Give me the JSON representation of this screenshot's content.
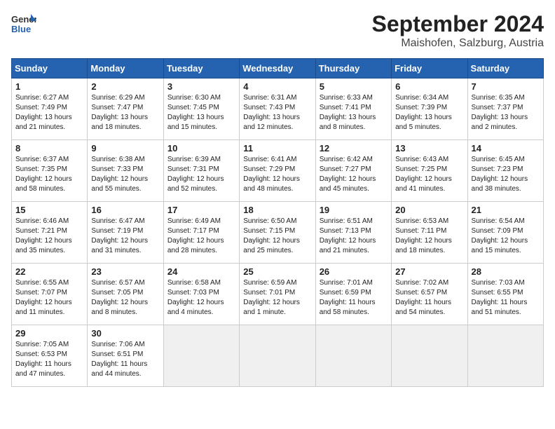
{
  "header": {
    "logo_line1": "General",
    "logo_line2": "Blue",
    "month": "September 2024",
    "location": "Maishofen, Salzburg, Austria"
  },
  "days_of_week": [
    "Sunday",
    "Monday",
    "Tuesday",
    "Wednesday",
    "Thursday",
    "Friday",
    "Saturday"
  ],
  "weeks": [
    [
      {
        "day": "1",
        "content": "Sunrise: 6:27 AM\nSunset: 7:49 PM\nDaylight: 13 hours\nand 21 minutes."
      },
      {
        "day": "2",
        "content": "Sunrise: 6:29 AM\nSunset: 7:47 PM\nDaylight: 13 hours\nand 18 minutes."
      },
      {
        "day": "3",
        "content": "Sunrise: 6:30 AM\nSunset: 7:45 PM\nDaylight: 13 hours\nand 15 minutes."
      },
      {
        "day": "4",
        "content": "Sunrise: 6:31 AM\nSunset: 7:43 PM\nDaylight: 13 hours\nand 12 minutes."
      },
      {
        "day": "5",
        "content": "Sunrise: 6:33 AM\nSunset: 7:41 PM\nDaylight: 13 hours\nand 8 minutes."
      },
      {
        "day": "6",
        "content": "Sunrise: 6:34 AM\nSunset: 7:39 PM\nDaylight: 13 hours\nand 5 minutes."
      },
      {
        "day": "7",
        "content": "Sunrise: 6:35 AM\nSunset: 7:37 PM\nDaylight: 13 hours\nand 2 minutes."
      }
    ],
    [
      {
        "day": "8",
        "content": "Sunrise: 6:37 AM\nSunset: 7:35 PM\nDaylight: 12 hours\nand 58 minutes."
      },
      {
        "day": "9",
        "content": "Sunrise: 6:38 AM\nSunset: 7:33 PM\nDaylight: 12 hours\nand 55 minutes."
      },
      {
        "day": "10",
        "content": "Sunrise: 6:39 AM\nSunset: 7:31 PM\nDaylight: 12 hours\nand 52 minutes."
      },
      {
        "day": "11",
        "content": "Sunrise: 6:41 AM\nSunset: 7:29 PM\nDaylight: 12 hours\nand 48 minutes."
      },
      {
        "day": "12",
        "content": "Sunrise: 6:42 AM\nSunset: 7:27 PM\nDaylight: 12 hours\nand 45 minutes."
      },
      {
        "day": "13",
        "content": "Sunrise: 6:43 AM\nSunset: 7:25 PM\nDaylight: 12 hours\nand 41 minutes."
      },
      {
        "day": "14",
        "content": "Sunrise: 6:45 AM\nSunset: 7:23 PM\nDaylight: 12 hours\nand 38 minutes."
      }
    ],
    [
      {
        "day": "15",
        "content": "Sunrise: 6:46 AM\nSunset: 7:21 PM\nDaylight: 12 hours\nand 35 minutes."
      },
      {
        "day": "16",
        "content": "Sunrise: 6:47 AM\nSunset: 7:19 PM\nDaylight: 12 hours\nand 31 minutes."
      },
      {
        "day": "17",
        "content": "Sunrise: 6:49 AM\nSunset: 7:17 PM\nDaylight: 12 hours\nand 28 minutes."
      },
      {
        "day": "18",
        "content": "Sunrise: 6:50 AM\nSunset: 7:15 PM\nDaylight: 12 hours\nand 25 minutes."
      },
      {
        "day": "19",
        "content": "Sunrise: 6:51 AM\nSunset: 7:13 PM\nDaylight: 12 hours\nand 21 minutes."
      },
      {
        "day": "20",
        "content": "Sunrise: 6:53 AM\nSunset: 7:11 PM\nDaylight: 12 hours\nand 18 minutes."
      },
      {
        "day": "21",
        "content": "Sunrise: 6:54 AM\nSunset: 7:09 PM\nDaylight: 12 hours\nand 15 minutes."
      }
    ],
    [
      {
        "day": "22",
        "content": "Sunrise: 6:55 AM\nSunset: 7:07 PM\nDaylight: 12 hours\nand 11 minutes."
      },
      {
        "day": "23",
        "content": "Sunrise: 6:57 AM\nSunset: 7:05 PM\nDaylight: 12 hours\nand 8 minutes."
      },
      {
        "day": "24",
        "content": "Sunrise: 6:58 AM\nSunset: 7:03 PM\nDaylight: 12 hours\nand 4 minutes."
      },
      {
        "day": "25",
        "content": "Sunrise: 6:59 AM\nSunset: 7:01 PM\nDaylight: 12 hours\nand 1 minute."
      },
      {
        "day": "26",
        "content": "Sunrise: 7:01 AM\nSunset: 6:59 PM\nDaylight: 11 hours\nand 58 minutes."
      },
      {
        "day": "27",
        "content": "Sunrise: 7:02 AM\nSunset: 6:57 PM\nDaylight: 11 hours\nand 54 minutes."
      },
      {
        "day": "28",
        "content": "Sunrise: 7:03 AM\nSunset: 6:55 PM\nDaylight: 11 hours\nand 51 minutes."
      }
    ],
    [
      {
        "day": "29",
        "content": "Sunrise: 7:05 AM\nSunset: 6:53 PM\nDaylight: 11 hours\nand 47 minutes."
      },
      {
        "day": "30",
        "content": "Sunrise: 7:06 AM\nSunset: 6:51 PM\nDaylight: 11 hours\nand 44 minutes."
      },
      {
        "day": "",
        "content": ""
      },
      {
        "day": "",
        "content": ""
      },
      {
        "day": "",
        "content": ""
      },
      {
        "day": "",
        "content": ""
      },
      {
        "day": "",
        "content": ""
      }
    ]
  ]
}
